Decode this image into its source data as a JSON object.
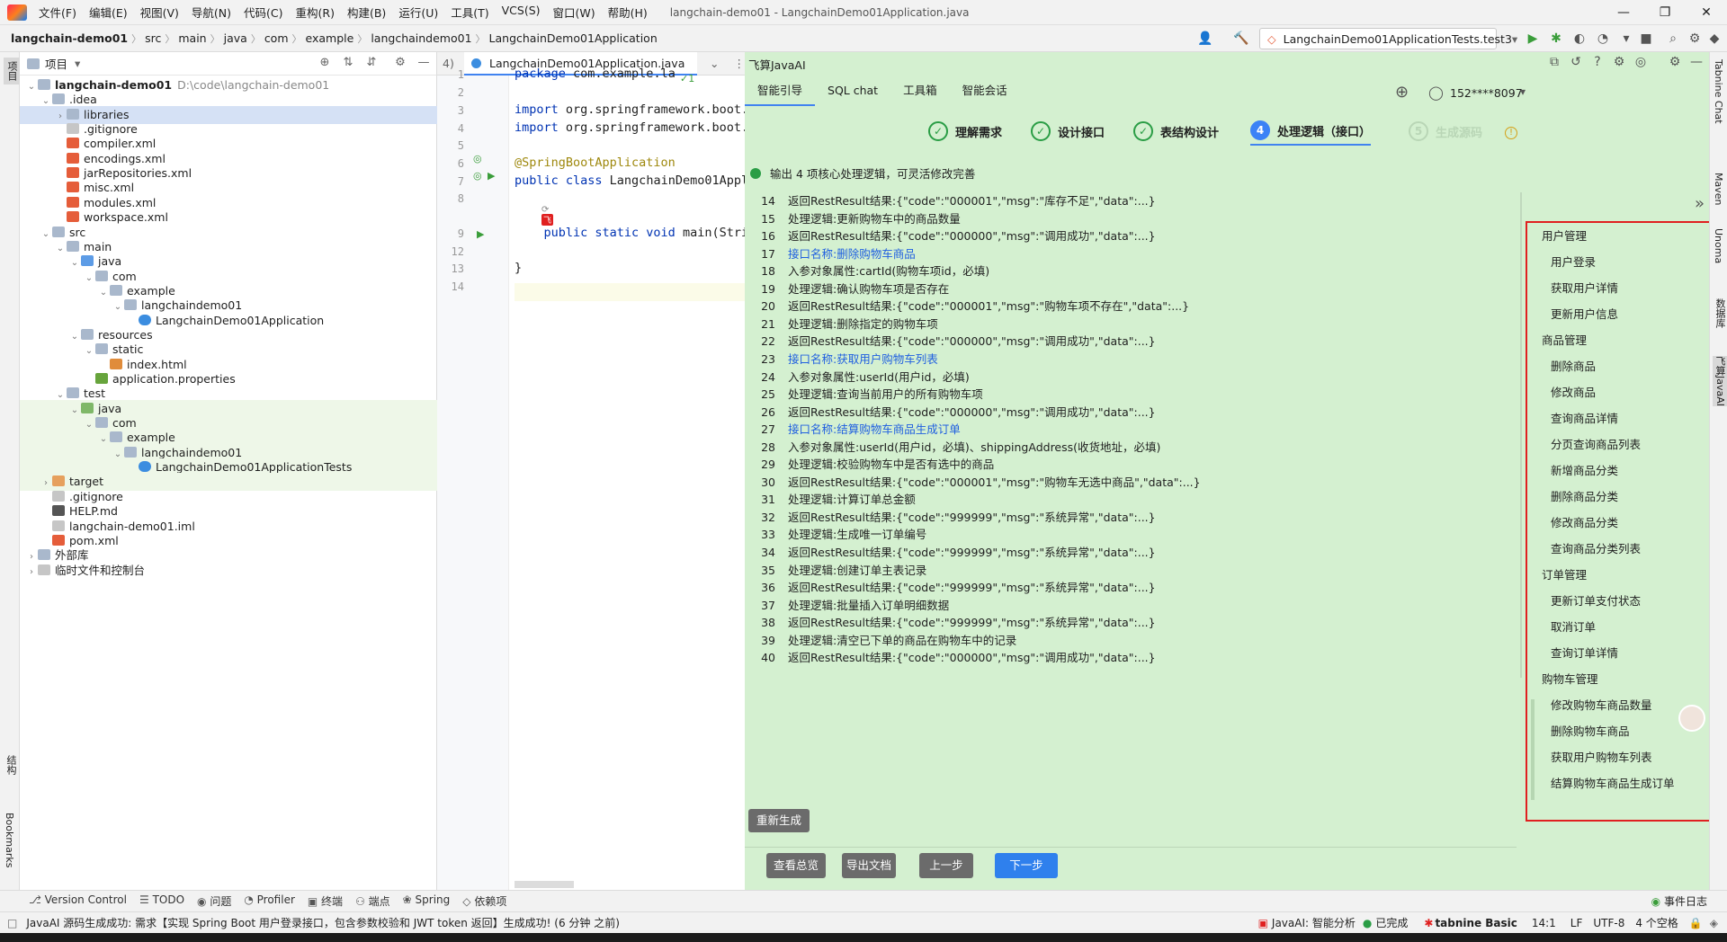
{
  "menubar": {
    "items": [
      "文件(F)",
      "编辑(E)",
      "视图(V)",
      "导航(N)",
      "代码(C)",
      "重构(R)",
      "构建(B)",
      "运行(U)",
      "工具(T)",
      "VCS(S)",
      "窗口(W)",
      "帮助(H)"
    ],
    "title": "langchain-demo01 - LangchainDemo01Application.java"
  },
  "navbar": {
    "crumbs": [
      "langchain-demo01",
      "src",
      "main",
      "java",
      "com",
      "example",
      "langchaindemo01",
      "LangchainDemo01Application"
    ],
    "run_config": "LangchainDemo01ApplicationTests.test3"
  },
  "leftstripe": {
    "project": "项目",
    "structure": "结构",
    "bookmarks": "Bookmarks"
  },
  "project": {
    "header": "项目",
    "rows": [
      {
        "depth": 0,
        "label": "langchain-demo01",
        "path": "D:\\code\\langchain-demo01",
        "icon": "folder",
        "arrow": "v",
        "bold": true
      },
      {
        "depth": 1,
        "label": ".idea",
        "icon": "folder",
        "arrow": "v"
      },
      {
        "depth": 2,
        "label": "libraries",
        "icon": "folder",
        "arrow": ">",
        "sel": true
      },
      {
        "depth": 2,
        "label": ".gitignore",
        "icon": "file"
      },
      {
        "depth": 2,
        "label": "compiler.xml",
        "icon": "xml"
      },
      {
        "depth": 2,
        "label": "encodings.xml",
        "icon": "xml"
      },
      {
        "depth": 2,
        "label": "jarRepositories.xml",
        "icon": "xml"
      },
      {
        "depth": 2,
        "label": "misc.xml",
        "icon": "xml"
      },
      {
        "depth": 2,
        "label": "modules.xml",
        "icon": "xml"
      },
      {
        "depth": 2,
        "label": "workspace.xml",
        "icon": "xml"
      },
      {
        "depth": 1,
        "label": "src",
        "icon": "folder",
        "arrow": "v"
      },
      {
        "depth": 2,
        "label": "main",
        "icon": "folder",
        "arrow": "v"
      },
      {
        "depth": 3,
        "label": "java",
        "icon": "folder blue",
        "arrow": "v"
      },
      {
        "depth": 4,
        "label": "com",
        "icon": "folder",
        "arrow": "v"
      },
      {
        "depth": 5,
        "label": "example",
        "icon": "folder",
        "arrow": "v"
      },
      {
        "depth": 6,
        "label": "langchaindemo01",
        "icon": "folder",
        "arrow": "v"
      },
      {
        "depth": 7,
        "label": "LangchainDemo01Application",
        "icon": "java"
      },
      {
        "depth": 3,
        "label": "resources",
        "icon": "folder",
        "arrow": "v"
      },
      {
        "depth": 4,
        "label": "static",
        "icon": "folder",
        "arrow": "v"
      },
      {
        "depth": 5,
        "label": "index.html",
        "icon": "html"
      },
      {
        "depth": 4,
        "label": "application.properties",
        "icon": "prop"
      },
      {
        "depth": 2,
        "label": "test",
        "icon": "folder",
        "arrow": "v"
      },
      {
        "depth": 3,
        "label": "java",
        "icon": "folder green",
        "arrow": "v",
        "green": true
      },
      {
        "depth": 4,
        "label": "com",
        "icon": "folder",
        "arrow": "v",
        "green": true
      },
      {
        "depth": 5,
        "label": "example",
        "icon": "folder",
        "arrow": "v",
        "green": true
      },
      {
        "depth": 6,
        "label": "langchaindemo01",
        "icon": "folder",
        "arrow": "v",
        "green": true
      },
      {
        "depth": 7,
        "label": "LangchainDemo01ApplicationTests",
        "icon": "java",
        "green": true
      },
      {
        "depth": 1,
        "label": "target",
        "icon": "folder orange",
        "arrow": ">",
        "green": true
      },
      {
        "depth": 1,
        "label": ".gitignore",
        "icon": "file"
      },
      {
        "depth": 1,
        "label": "HELP.md",
        "icon": "md"
      },
      {
        "depth": 1,
        "label": "langchain-demo01.iml",
        "icon": "file"
      },
      {
        "depth": 1,
        "label": "pom.xml",
        "icon": "xml"
      },
      {
        "depth": 0,
        "label": "外部库",
        "icon": "folder",
        "arrow": ">"
      },
      {
        "depth": 0,
        "label": "临时文件和控制台",
        "icon": "file",
        "arrow": ">"
      }
    ]
  },
  "editor": {
    "tab_prefix": "4)",
    "tab": "LangchainDemo01Application.java",
    "inspection": "✓1",
    "lines": [
      {
        "n": "1",
        "html": "<span class=\"kw\">package</span> com.example.la"
      },
      {
        "n": "2",
        "html": ""
      },
      {
        "n": "3",
        "html": "<span class=\"kw\">import</span> org.springframework.boot."
      },
      {
        "n": "4",
        "html": "<span class=\"kw\">import</span> org.springframework.boot."
      },
      {
        "n": "5",
        "html": ""
      },
      {
        "n": "6",
        "html": "<span class=\"an\">@SpringBootApplication</span>"
      },
      {
        "n": "7",
        "html": "<span class=\"kw\">public class</span> LangchainDemo01Appl"
      },
      {
        "n": "8",
        "html": ""
      },
      {
        "n": "9",
        "html": "    <span class=\"kw\">public static void</span> main(Stri"
      },
      {
        "n": "12",
        "html": ""
      },
      {
        "n": "13",
        "html": "}"
      },
      {
        "n": "14",
        "html": ""
      }
    ]
  },
  "aipanel": {
    "title": "飞算JavaAI",
    "tabs": [
      "智能引导",
      "SQL chat",
      "工具箱",
      "智能会话"
    ],
    "user": "152****8097",
    "steps": [
      {
        "num": "✓",
        "label": "理解需求",
        "state": "done"
      },
      {
        "num": "✓",
        "label": "设计接口",
        "state": "done"
      },
      {
        "num": "✓",
        "label": "表结构设计",
        "state": "done"
      },
      {
        "num": "4",
        "label": "处理逻辑（接口）",
        "state": "active"
      },
      {
        "num": "5",
        "label": "生成源码",
        "state": "dim"
      }
    ],
    "info": "输出 4 项核心处理逻辑，可灵活修改完善",
    "lines": [
      {
        "n": "14",
        "t": "返回RestResult结果:{\"code\":\"000001\",\"msg\":\"库存不足\",\"data\":...}"
      },
      {
        "n": "15",
        "t": "处理逻辑:更新购物车中的商品数量"
      },
      {
        "n": "16",
        "t": "返回RestResult结果:{\"code\":\"000000\",\"msg\":\"调用成功\",\"data\":...}"
      },
      {
        "n": "17",
        "t": "接口名称:删除购物车商品",
        "link": true
      },
      {
        "n": "18",
        "t": "入参对象属性:cartId(购物车项id，必填)"
      },
      {
        "n": "19",
        "t": "处理逻辑:确认购物车项是否存在"
      },
      {
        "n": "20",
        "t": "返回RestResult结果:{\"code\":\"000001\",\"msg\":\"购物车项不存在\",\"data\":...}"
      },
      {
        "n": "21",
        "t": "处理逻辑:删除指定的购物车项"
      },
      {
        "n": "22",
        "t": "返回RestResult结果:{\"code\":\"000000\",\"msg\":\"调用成功\",\"data\":...}"
      },
      {
        "n": "23",
        "t": "接口名称:获取用户购物车列表",
        "link": true
      },
      {
        "n": "24",
        "t": "入参对象属性:userId(用户id，必填)"
      },
      {
        "n": "25",
        "t": "处理逻辑:查询当前用户的所有购物车项"
      },
      {
        "n": "26",
        "t": "返回RestResult结果:{\"code\":\"000000\",\"msg\":\"调用成功\",\"data\":...}"
      },
      {
        "n": "27",
        "t": "接口名称:结算购物车商品生成订单",
        "link": true
      },
      {
        "n": "28",
        "t": "入参对象属性:userId(用户id，必填)、shippingAddress(收货地址，必填)"
      },
      {
        "n": "29",
        "t": "处理逻辑:校验购物车中是否有选中的商品"
      },
      {
        "n": "30",
        "t": "返回RestResult结果:{\"code\":\"000001\",\"msg\":\"购物车无选中商品\",\"data\":...}"
      },
      {
        "n": "31",
        "t": "处理逻辑:计算订单总金额"
      },
      {
        "n": "32",
        "t": "返回RestResult结果:{\"code\":\"999999\",\"msg\":\"系统异常\",\"data\":...}"
      },
      {
        "n": "33",
        "t": "处理逻辑:生成唯一订单编号"
      },
      {
        "n": "34",
        "t": "返回RestResult结果:{\"code\":\"999999\",\"msg\":\"系统异常\",\"data\":...}"
      },
      {
        "n": "35",
        "t": "处理逻辑:创建订单主表记录"
      },
      {
        "n": "36",
        "t": "返回RestResult结果:{\"code\":\"999999\",\"msg\":\"系统异常\",\"data\":...}"
      },
      {
        "n": "37",
        "t": "处理逻辑:批量插入订单明细数据"
      },
      {
        "n": "38",
        "t": "返回RestResult结果:{\"code\":\"999999\",\"msg\":\"系统异常\",\"data\":...}"
      },
      {
        "n": "39",
        "t": "处理逻辑:清空已下单的商品在购物车中的记录"
      },
      {
        "n": "40",
        "t": "返回RestResult结果:{\"code\":\"000000\",\"msg\":\"调用成功\",\"data\":...}"
      }
    ],
    "outline": [
      {
        "t": "用户管理",
        "grp": true
      },
      {
        "t": "用户登录"
      },
      {
        "t": "获取用户详情"
      },
      {
        "t": "更新用户信息"
      },
      {
        "t": "商品管理",
        "grp": true
      },
      {
        "t": "删除商品"
      },
      {
        "t": "修改商品"
      },
      {
        "t": "查询商品详情"
      },
      {
        "t": "分页查询商品列表"
      },
      {
        "t": "新增商品分类"
      },
      {
        "t": "删除商品分类"
      },
      {
        "t": "修改商品分类"
      },
      {
        "t": "查询商品分类列表"
      },
      {
        "t": "订单管理",
        "grp": true
      },
      {
        "t": "更新订单支付状态"
      },
      {
        "t": "取消订单"
      },
      {
        "t": "查询订单详情"
      },
      {
        "t": "购物车管理",
        "grp": true
      },
      {
        "t": "修改购物车商品数量"
      },
      {
        "t": "删除购物车商品"
      },
      {
        "t": "获取用户购物车列表"
      },
      {
        "t": "结算购物车商品生成订单"
      }
    ],
    "regen": "重新生成",
    "buttons": {
      "overview": "查看总览",
      "export": "导出文档",
      "prev": "上一步",
      "next": "下一步"
    }
  },
  "rightstripe": {
    "tabnine": "Tabnine Chat",
    "maven": "Maven",
    "unoma": "Unoma",
    "db": "数据库",
    "feisuan": "飞算JavaAI"
  },
  "toolbar": {
    "items": [
      "Version Control",
      "TODO",
      "问题",
      "Profiler",
      "终端",
      "端点",
      "Spring",
      "依赖项"
    ],
    "events": "事件日志"
  },
  "status": {
    "message": "JavaAI 源码生成成功: 需求【实现 Spring Boot 用户登录接口，包含参数校验和 JWT token 返回】生成成功! (6 分钟 之前)",
    "javaai": "JavaAI: 智能分析",
    "done": "已完成",
    "tabnine": "tabnine",
    "basic": "Basic",
    "pos": "14:1",
    "lf": "LF",
    "enc": "UTF-8",
    "indent": "4 个空格"
  }
}
